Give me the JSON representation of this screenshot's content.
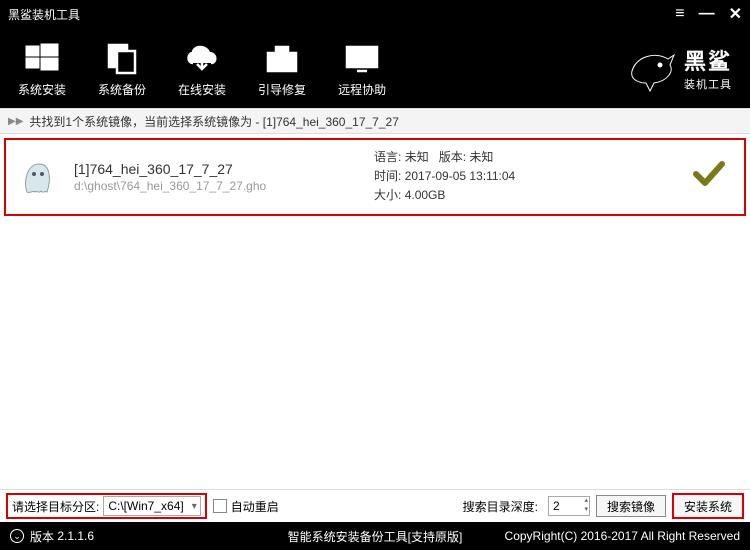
{
  "titlebar": {
    "title": "黑鲨装机工具"
  },
  "nav": {
    "items": [
      {
        "label": "系统安装"
      },
      {
        "label": "系统备份"
      },
      {
        "label": "在线安装"
      },
      {
        "label": "引导修复"
      },
      {
        "label": "远程协助"
      }
    ]
  },
  "logo": {
    "big": "黑鲨",
    "small": "装机工具"
  },
  "pathbar": {
    "text": "共找到1个系统镜像，当前选择系统镜像为 - [1]764_hei_360_17_7_27"
  },
  "image": {
    "title": "[1]764_hei_360_17_7_27",
    "path": "d:\\ghost\\764_hei_360_17_7_27.gho",
    "lang_label": "语言:",
    "lang_value": "未知",
    "ver_label": "版本:",
    "ver_value": "未知",
    "time_label": "时间:",
    "time_value": "2017-09-05 13:11:04",
    "size_label": "大小:",
    "size_value": "4.00GB"
  },
  "toolbar": {
    "partition_label": "请选择目标分区:",
    "partition_value": "C:\\[Win7_x64]",
    "auto_restart_label": "自动重启",
    "depth_label": "搜索目录深度:",
    "depth_value": "2",
    "search_btn": "搜索镜像",
    "install_btn": "安装系统"
  },
  "status": {
    "version_label": "版本",
    "version_value": "2.1.1.6",
    "center": "智能系统安装备份工具[支持原版]",
    "right": "CopyRight(C) 2016-2017 All Right Reserved"
  }
}
